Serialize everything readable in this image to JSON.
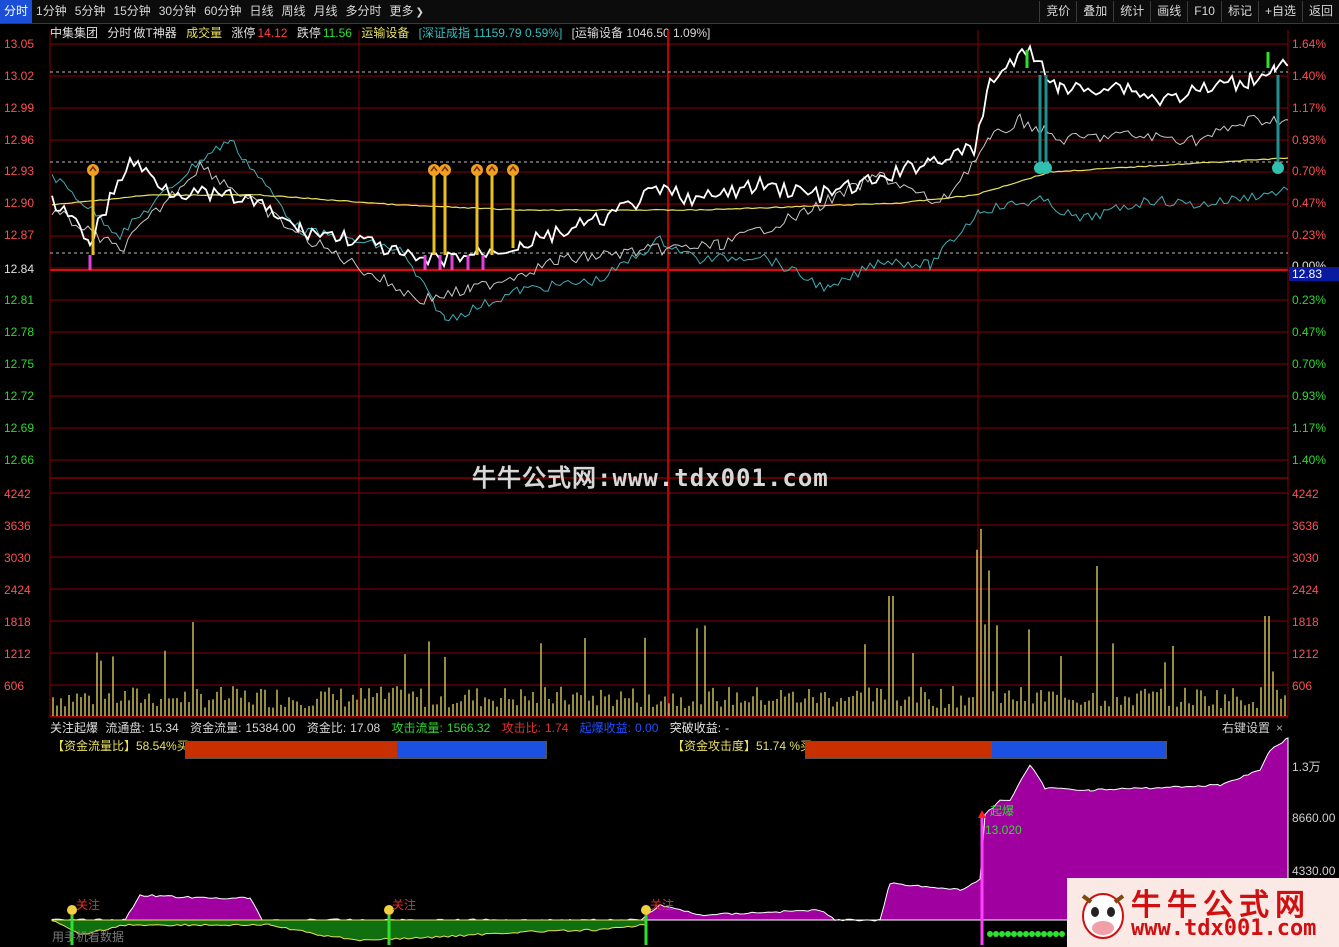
{
  "toolbar": {
    "periods": [
      "分时",
      "1分钟",
      "5分钟",
      "15分钟",
      "30分钟",
      "60分钟",
      "日线",
      "周线",
      "月线",
      "多分时",
      "更多"
    ],
    "active_period": "分时",
    "tools": [
      "竞价",
      "叠加",
      "统计",
      "画线",
      "F10",
      "标记",
      "+自选",
      "返回"
    ]
  },
  "stock_info": {
    "name": "中集集团",
    "mode": "分时",
    "indicator": "做T神器",
    "volume_label": "成交量",
    "limit_up_label": "涨停",
    "limit_up_value": "14.12",
    "limit_down_label": "跌停",
    "limit_down_value": "11.56",
    "sector": "运输设备",
    "index_compare": "[深证成指 11159.79 0.59%]",
    "sector_compare": "[运输设备 1046.50 1.09%]"
  },
  "price_axis": {
    "labels": [
      "13.05",
      "13.02",
      "12.99",
      "12.96",
      "12.93",
      "12.90",
      "12.87",
      "12.84",
      "12.81",
      "12.78",
      "12.75",
      "12.72",
      "12.69",
      "12.66"
    ],
    "pct_labels": [
      "1.64%",
      "1.40%",
      "1.17%",
      "0.93%",
      "0.70%",
      "0.47%",
      "0.23%",
      "0.00%",
      "0.23%",
      "0.47%",
      "0.70%",
      "0.93%",
      "1.17%",
      "1.40%"
    ],
    "current_price": "12.83"
  },
  "volume_axis": {
    "labels": [
      "4242",
      "3636",
      "3030",
      "2424",
      "1818",
      "1212",
      "606"
    ]
  },
  "panel": {
    "title": "关注起爆",
    "items": [
      {
        "label": "流通盘:",
        "value": "15.34",
        "color": "#d8d8d8"
      },
      {
        "label": "资金流量:",
        "value": "15384.00",
        "color": "#d8d8d8"
      },
      {
        "label": "资金比:",
        "value": "17.08",
        "color": "#d8d8d8"
      },
      {
        "label": "攻击流量:",
        "value": "1566.32",
        "color": "#30d830"
      },
      {
        "label": "攻击比:",
        "value": "1.74",
        "color": "#e03030"
      },
      {
        "label": "起爆收益:",
        "value": "0.00",
        "color": "#2050ff"
      },
      {
        "label": "突破收益:",
        "value": "-",
        "color": "#e8e8e8"
      }
    ],
    "settings_label": "右键设置",
    "close_label": "×",
    "flow_ratio_label": "【资金流量比】58.54%买",
    "flow_ratio": 0.5854,
    "attack_label": "【资金攻击度】51.74 %买",
    "attack_ratio": 0.5174,
    "right_axis": [
      "1.3万",
      "8660.00",
      "4330.00"
    ],
    "tags": {
      "watch": "关注",
      "burst": "起爆",
      "burst_price": "13.020",
      "bottom_left": "用手机看数据"
    }
  },
  "watermark": "牛牛公式网:www.tdx001.com",
  "logo": {
    "title": "牛牛公式网",
    "url": "www.tdx001.com"
  },
  "colors": {
    "grid": "#8a0000",
    "price_line": "#ffffff",
    "avg_line": "#e8e060",
    "compare_line": "#3fb0b8",
    "volume_bar": "#e8d860",
    "fill_magenta": "#a000a0",
    "fill_green": "#107010"
  }
}
